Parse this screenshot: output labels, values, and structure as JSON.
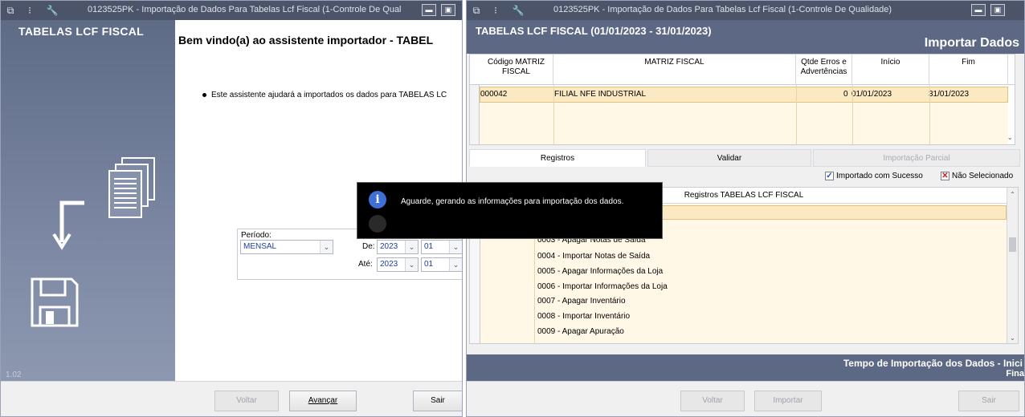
{
  "left_window": {
    "title": "0123525PK - Importação de Dados Para Tabelas Lcf Fiscal (1-Controle De Qual",
    "side_title": "TABELAS LCF FISCAL",
    "version": "1.02",
    "wizard_title": "Bem vindo(a) ao assistente importador - TABEL",
    "bullet_text": "Este assistente ajudará a importados os dados para TABELAS LC",
    "periodo": {
      "label": "Período:",
      "tipo_value": "MENSAL",
      "de_label": "De:",
      "ate_label": "Até:",
      "de_ano": "2023",
      "de_mes": "01",
      "ate_ano": "2023",
      "ate_mes": "01"
    },
    "buttons": {
      "voltar": "Voltar",
      "avancar": "Avançar",
      "sair": "Sair"
    }
  },
  "right_window": {
    "title": "0123525PK - Importação de Dados Para Tabelas Lcf Fiscal (1-Controle De Qualidade)",
    "header_title": "TABELAS LCF FISCAL (01/01/2023 - 31/01/2023)",
    "header_subtitle": "Importar Dados",
    "grid_headers": {
      "codigo": "Código MATRIZ FISCAL",
      "matriz": "MATRIZ FISCAL",
      "qtde": "Qtde Erros e Advertências",
      "inicio": "Início",
      "fim": "Fim"
    },
    "grid_row": {
      "codigo": "000042",
      "matriz": "FILIAL NFE INDUSTRIAL",
      "qtde": "0",
      "inicio": "01/01/2023",
      "fim": "31/01/2023"
    },
    "tabs": [
      "Registros",
      "Validar",
      "Importação Parcial"
    ],
    "legend": {
      "sucesso": "Importado com Sucesso",
      "nao_selecionado": "Não Selecionado"
    },
    "registros_header": "Registros TABELAS LCF FISCAL",
    "registros": [
      "0003 - Apagar Notas de Saída",
      "0004 - Importar Notas de Saída",
      "0005 - Apagar Informações da Loja",
      "0006 - Importar Informações da Loja",
      "0007 - Apagar Inventário",
      "0008 - Importar Inventário",
      "0009 - Apagar Apuração"
    ],
    "footer": {
      "line1": "Tempo de Importação dos Dados - Inici",
      "line2": "Fina"
    },
    "buttons": {
      "voltar": "Voltar",
      "importar": "Importar",
      "sair": "Sair"
    }
  },
  "dialog": {
    "message": "Aguarde, gerando as informações para importação dos dados."
  },
  "colors": {
    "titlebar": "#4b5468",
    "header": "#5d6984",
    "row_highlight": "#fbe9c4",
    "dialog_bg": "#000000"
  },
  "icons": [
    "app-menu-icon",
    "traffic-light-icon",
    "wrench-icon",
    "minimize-icon",
    "maximize-icon",
    "documents-icon",
    "arrow-down-left-icon",
    "floppy-disk-icon",
    "info-icon"
  ]
}
